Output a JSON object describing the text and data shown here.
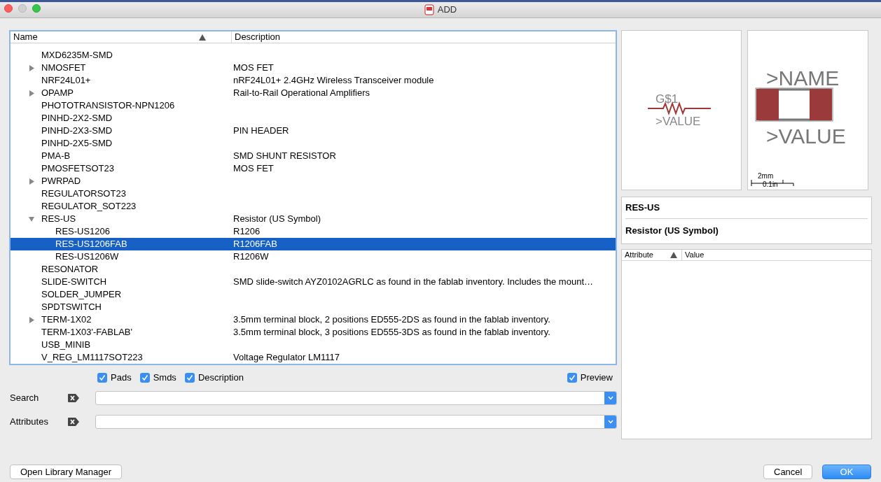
{
  "window": {
    "title": "ADD"
  },
  "table": {
    "columns": [
      {
        "label": "Name",
        "sorted": true
      },
      {
        "label": "Description",
        "sorted": false
      }
    ],
    "rows": [
      {
        "name": "MXD6235M-SMD",
        "description": "",
        "kind": "item",
        "selected": false
      },
      {
        "name": "NMOSFET",
        "description": "MOS FET",
        "kind": "group",
        "expanded": false,
        "selected": false
      },
      {
        "name": "NRF24L01+",
        "description": "nRF24L01+ 2.4GHz Wireless Transceiver module",
        "kind": "item",
        "selected": false
      },
      {
        "name": "OPAMP",
        "description": "Rail-to-Rail Operational Amplifiers",
        "kind": "group",
        "expanded": false,
        "selected": false
      },
      {
        "name": "PHOTOTRANSISTOR-NPN1206",
        "description": "",
        "kind": "item",
        "selected": false
      },
      {
        "name": "PINHD-2X2-SMD",
        "description": "",
        "kind": "item",
        "selected": false
      },
      {
        "name": "PINHD-2X3-SMD",
        "description": "PIN HEADER",
        "kind": "item",
        "selected": false
      },
      {
        "name": "PINHD-2X5-SMD",
        "description": "",
        "kind": "item",
        "selected": false
      },
      {
        "name": "PMA-B",
        "description": "SMD SHUNT RESISTOR",
        "kind": "item",
        "selected": false
      },
      {
        "name": "PMOSFETSOT23",
        "description": "MOS FET",
        "kind": "item",
        "selected": false
      },
      {
        "name": "PWRPAD",
        "description": "",
        "kind": "group",
        "expanded": false,
        "selected": false
      },
      {
        "name": "REGULATORSOT23",
        "description": "",
        "kind": "item",
        "selected": false
      },
      {
        "name": "REGULATOR_SOT223",
        "description": "",
        "kind": "item",
        "selected": false
      },
      {
        "name": "RES-US",
        "description": "Resistor (US Symbol)",
        "kind": "group",
        "expanded": true,
        "selected": false,
        "children": [
          {
            "name": "RES-US1206",
            "description": "R1206",
            "kind": "item",
            "selected": false
          },
          {
            "name": "RES-US1206FAB",
            "description": "R1206FAB",
            "kind": "item",
            "selected": true
          },
          {
            "name": "RES-US1206W",
            "description": "R1206W",
            "kind": "item",
            "selected": false
          }
        ]
      },
      {
        "name": "RESONATOR",
        "description": "",
        "kind": "item",
        "selected": false
      },
      {
        "name": "SLIDE-SWITCH",
        "description": "SMD slide-switch AYZ0102AGRLC as found in the fablab inventory.  Includes the mount…",
        "kind": "item",
        "selected": false
      },
      {
        "name": "SOLDER_JUMPER",
        "description": "",
        "kind": "item",
        "selected": false
      },
      {
        "name": "SPDTSWITCH",
        "description": "",
        "kind": "item",
        "selected": false
      },
      {
        "name": "TERM-1X02",
        "description": "3.5mm terminal block, 2 positions ED555-2DS as found in the fablab inventory.",
        "kind": "group",
        "expanded": false,
        "selected": false
      },
      {
        "name": "TERM-1X03'-FABLAB'",
        "description": "3.5mm terminal block, 3 positions ED555-3DS as found in the fablab inventory.",
        "kind": "item",
        "selected": false
      },
      {
        "name": "USB_MINIB",
        "description": "",
        "kind": "item",
        "selected": false
      },
      {
        "name": "V_REG_LM1117SOT223",
        "description": "Voltage Regulator LM1117",
        "kind": "item",
        "selected": false
      }
    ]
  },
  "filters": [
    {
      "label": "Pads",
      "checked": true
    },
    {
      "label": "Smds",
      "checked": true
    },
    {
      "label": "Description",
      "checked": true
    }
  ],
  "preview_toggle": {
    "label": "Preview",
    "checked": true
  },
  "fields": [
    {
      "label": "Search"
    },
    {
      "label": "Attributes"
    }
  ],
  "symbol_preview": {
    "name": "G$1",
    "value": ">VALUE"
  },
  "package_preview": {
    "name": ">NAME",
    "value": ">VALUE",
    "scale_top": "2mm",
    "scale_bottom": "0.1in"
  },
  "info": {
    "name": "RES-US",
    "description": "Resistor (US Symbol)"
  },
  "attributes_table": {
    "columns": [
      {
        "label": "Attribute",
        "sorted": true
      },
      {
        "label": "Value",
        "sorted": false
      }
    ]
  },
  "buttons": [
    {
      "label": "Open Library Manager",
      "kind": "secondary"
    },
    {
      "label": "Cancel",
      "kind": "secondary"
    },
    {
      "label": "OK",
      "kind": "primary"
    }
  ]
}
